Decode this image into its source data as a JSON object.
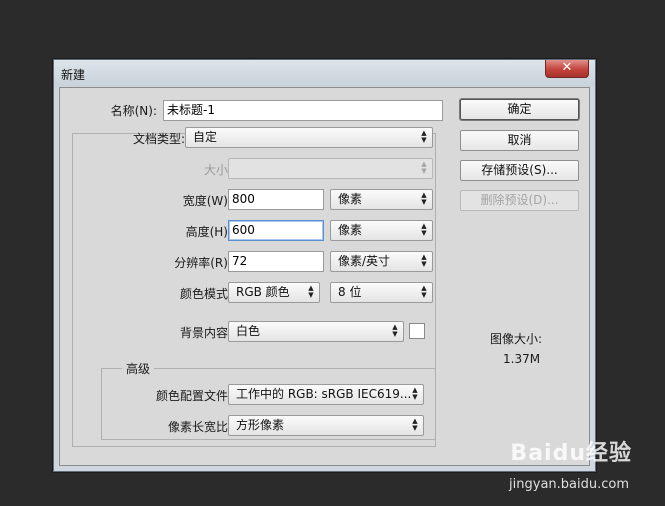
{
  "dialog": {
    "title": "新建",
    "close_icon": "close-x-icon"
  },
  "form": {
    "name": {
      "label": "名称(N):",
      "value": "未标题-1"
    },
    "preset": {
      "label": "文档类型:",
      "value": "自定"
    },
    "size": {
      "label": "大小:",
      "value": ""
    },
    "width": {
      "label": "宽度(W):",
      "value": "800",
      "unit": "像素"
    },
    "height": {
      "label": "高度(H):",
      "value": "600",
      "unit": "像素"
    },
    "resolution": {
      "label": "分辨率(R):",
      "value": "72",
      "unit": "像素/英寸"
    },
    "color_mode": {
      "label": "颜色模式:",
      "mode": "RGB 颜色",
      "depth": "8 位"
    },
    "background": {
      "label": "背景内容:",
      "value": "白色",
      "swatch_color": "#ffffff"
    },
    "advanced": {
      "title": "高级",
      "color_profile": {
        "label": "颜色配置文件:",
        "value": "工作中的 RGB: sRGB IEC619..."
      },
      "pixel_aspect": {
        "label": "像素长宽比:",
        "value": "方形像素"
      }
    }
  },
  "buttons": {
    "ok": "确定",
    "cancel": "取消",
    "save_preset": "存储预设(S)...",
    "delete_preset": "删除预设(D)..."
  },
  "image_size": {
    "label": "图像大小:",
    "value": "1.37M"
  },
  "watermark": {
    "brand": "Baidu经验",
    "url": "jingyan.baidu.com"
  }
}
